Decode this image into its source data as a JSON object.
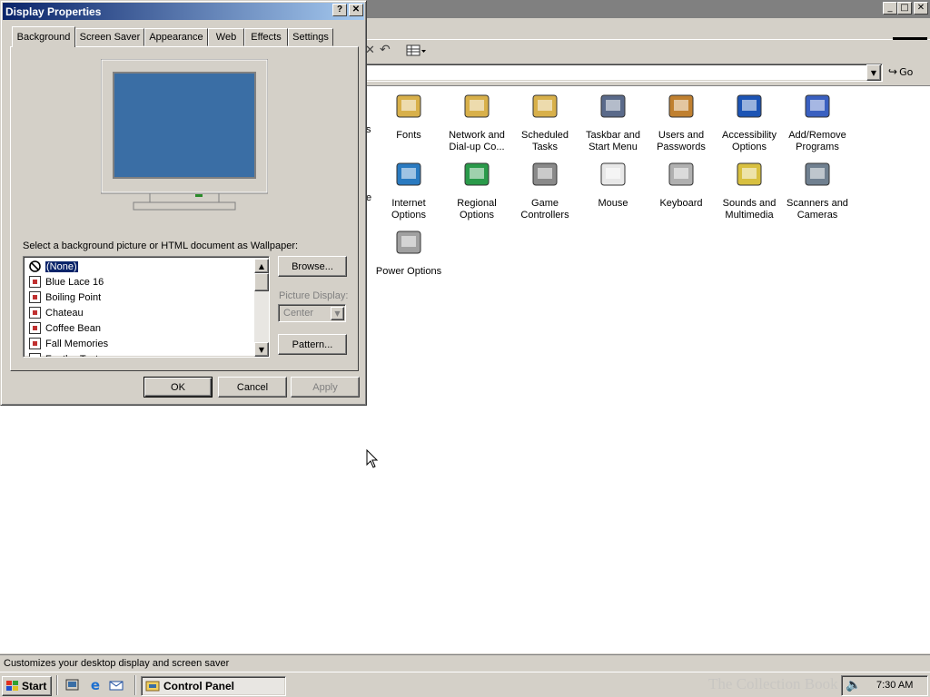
{
  "control_panel": {
    "window_controls": {
      "minimize": "_",
      "maximize": "□",
      "close": "✕"
    },
    "address": {
      "go_label": "Go"
    },
    "icons": [
      {
        "label": "Fonts",
        "col": 0,
        "row": 0,
        "color": "#d8b04a"
      },
      {
        "label": "Network and Dial-up Co...",
        "col": 1,
        "row": 0,
        "color": "#d8b04a"
      },
      {
        "label": "Scheduled Tasks",
        "col": 2,
        "row": 0,
        "color": "#d8b04a"
      },
      {
        "label": "Taskbar and Start Menu",
        "col": 3,
        "row": 0,
        "color": "#5a6a8a"
      },
      {
        "label": "Users and Passwords",
        "col": 4,
        "row": 0,
        "color": "#c08030"
      },
      {
        "label": "Accessibility Options",
        "col": 5,
        "row": 0,
        "color": "#1c54b4"
      },
      {
        "label": "Add/Remove Programs",
        "col": 6,
        "row": 0,
        "color": "#3a60c0"
      },
      {
        "label": "Internet Options",
        "col": 0,
        "row": 1,
        "color": "#2a7ac0"
      },
      {
        "label": "Regional Options",
        "col": 1,
        "row": 1,
        "color": "#2a9a4a"
      },
      {
        "label": "Game Controllers",
        "col": 2,
        "row": 1,
        "color": "#8a8a8a"
      },
      {
        "label": "Mouse",
        "col": 3,
        "row": 1,
        "color": "#e8e8e8"
      },
      {
        "label": "Keyboard",
        "col": 4,
        "row": 1,
        "color": "#b0b0b0"
      },
      {
        "label": "Sounds and Multimedia",
        "col": 5,
        "row": 1,
        "color": "#d8c040"
      },
      {
        "label": "Scanners and Cameras",
        "col": 6,
        "row": 1,
        "color": "#708090"
      },
      {
        "label": "Power Options",
        "col": 0,
        "row": 2,
        "color": "#a0a0a0"
      }
    ],
    "partial_labels": [
      "s",
      "e"
    ],
    "status_text": "Customizes your desktop display and screen saver"
  },
  "dialog": {
    "title": "Display Properties",
    "help_button": "?",
    "close_button": "✕",
    "tabs": [
      "Background",
      "Screen Saver",
      "Appearance",
      "Web",
      "Effects",
      "Settings"
    ],
    "active_tab": "Background",
    "preview_color": "#3a6ea5",
    "wallpaper_label": "Select a background picture or HTML document as Wallpaper:",
    "wallpapers": [
      "(None)",
      "Blue Lace 16",
      "Boiling Point",
      "Chateau",
      "Coffee Bean",
      "Fall Memories",
      "FeatherTexture"
    ],
    "selected_wallpaper": "(None)",
    "browse_label": "Browse...",
    "picture_display_label": "Picture Display:",
    "picture_display_value": "Center",
    "pattern_label": "Pattern...",
    "ok_label": "OK",
    "cancel_label": "Cancel",
    "apply_label": "Apply"
  },
  "taskbar": {
    "start_label": "Start",
    "task_label": "Control Panel",
    "clock": "7:30 AM",
    "watermark": "The Collection Book"
  }
}
